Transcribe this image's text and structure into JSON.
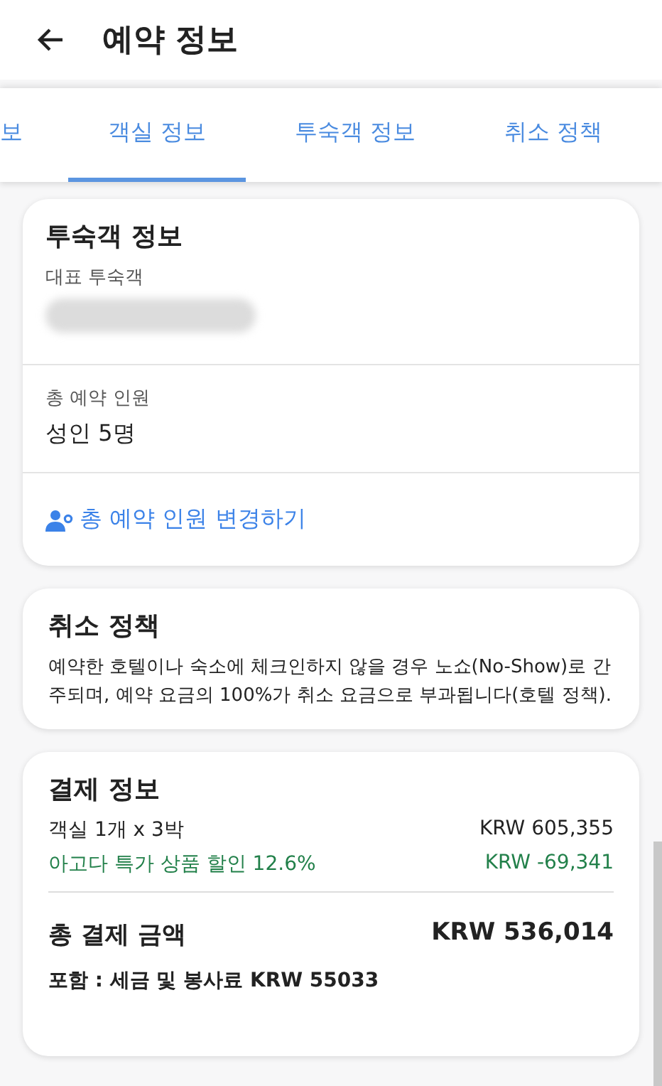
{
  "header": {
    "title": "예약 정보"
  },
  "tabs": [
    {
      "label": "보",
      "selected": false
    },
    {
      "label": "객실 정보",
      "selected": true
    },
    {
      "label": "투숙객 정보",
      "selected": false
    },
    {
      "label": "취소 정책",
      "selected": false
    }
  ],
  "guest_card": {
    "title": "투숙객 정보",
    "lead_label": "대표 투숙객",
    "lead_name_redacted": true,
    "count_label": "총 예약 인원",
    "count_value": "성인 5명",
    "change_link": "총 예약 인원 변경하기"
  },
  "cancel_card": {
    "title": "취소 정책",
    "text": "예약한 호텔이나 숙소에 체크인하지 않을 경우 노쇼(No-Show)로 간주되며, 예약 요금의 100%가 취소 요금으로 부과됩니다(호텔 정책)."
  },
  "payment_card": {
    "title": "결제 정보",
    "lines": [
      {
        "label": "객실 1개 x 3박",
        "amount": "KRW 605,355",
        "kind": "charge"
      },
      {
        "label": "아고다 특가 상품 할인 12.6%",
        "amount": "KRW -69,341",
        "kind": "discount"
      }
    ],
    "total_label": "총 결제 금액",
    "total_amount": "KRW 536,014",
    "tax_note": "포함 : 세금 및 봉사료 KRW 55033"
  }
}
